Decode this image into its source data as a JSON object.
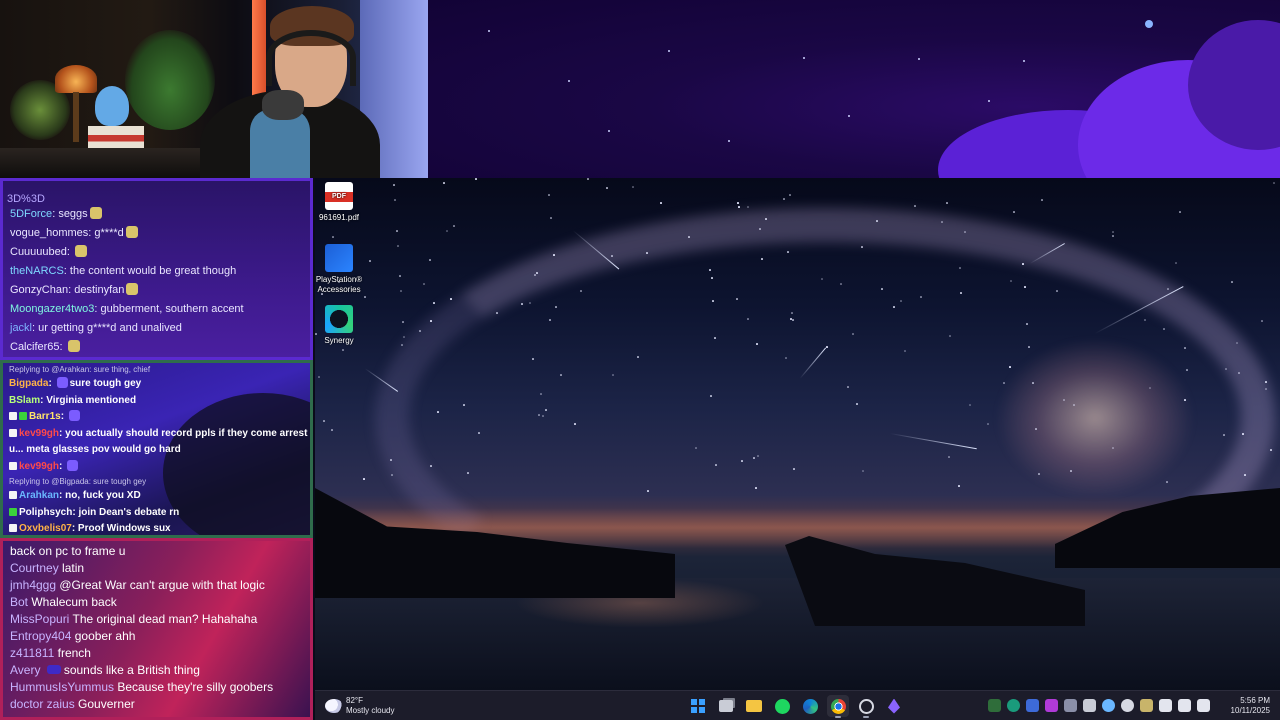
{
  "colors": {
    "chat1_bg": "#3d1a8c",
    "chat2_bg": "#3a24b4",
    "chat3_bg": "#8a1f5a",
    "taskbar": "#1c1c2a"
  },
  "chat1": {
    "header": "3D%3D",
    "messages": [
      {
        "user": "5DForce",
        "user_color": "#7fd9ff",
        "text": "seggs",
        "emote": true
      },
      {
        "user": "vogue_hommes",
        "user_color": "#e9e6ff",
        "text": "g****d",
        "emote": true
      },
      {
        "user": "Cuuuuubed",
        "user_color": "#e9e6ff",
        "text": "",
        "emote": true
      },
      {
        "user": "theNARCS",
        "user_color": "#7fd9ff",
        "text": "the content would be great though",
        "emote": false
      },
      {
        "user": "GonzyChan",
        "user_color": "#e9e6ff",
        "text": "destinyfan",
        "emote": true
      },
      {
        "user": "Moongazer4two3",
        "user_color": "#7ff5e0",
        "text": "gubberment, southern accent",
        "emote": false
      },
      {
        "user": "jackl",
        "user_color": "#7fb4ff",
        "text": "ur getting g****d and unalived",
        "emote": false
      },
      {
        "user": "Calcifer65",
        "user_color": "#e9e6ff",
        "text": "",
        "emote": true
      }
    ]
  },
  "chat2": {
    "lines": [
      {
        "kind": "reply",
        "text": "Replying to @Arahkan: sure thing, chief"
      },
      {
        "kind": "msg",
        "user": "Bigpada",
        "user_color": "#ffb347",
        "text": "sure tough gey",
        "badge": "none",
        "emote_before": true
      },
      {
        "kind": "msg",
        "user": "BSlam",
        "user_color": "#b7ff7a",
        "text": "Virginia mentioned",
        "badge": "none",
        "emote_before": false
      },
      {
        "kind": "msg",
        "user": "Barr1s",
        "user_color": "#ffe46a",
        "text": "",
        "badge": "white-green",
        "emote_before": false
      },
      {
        "kind": "msg",
        "user": "kev99gh",
        "user_color": "#ff4a4a",
        "text": "you actually should record ppls if they come arrest",
        "badge": "white",
        "emote_before": false
      },
      {
        "kind": "cont",
        "text": "u... meta glasses pov would go hard"
      },
      {
        "kind": "msg",
        "user": "kev99gh",
        "user_color": "#ff4a4a",
        "text": "",
        "badge": "white",
        "emote_before": false
      },
      {
        "kind": "reply",
        "text": "Replying to @Bigpada: sure tough gey"
      },
      {
        "kind": "msg",
        "user": "Arahkan",
        "user_color": "#6ab7ff",
        "text": "no, fuck you XD",
        "badge": "white",
        "emote_before": false
      },
      {
        "kind": "msg",
        "user": "Poliphsych",
        "user_color": "#ffffff",
        "text": "join Dean's debate rn",
        "badge": "green",
        "emote_before": false
      },
      {
        "kind": "msg",
        "user": "Oxvbelis07",
        "user_color": "#ffb347",
        "text": "Proof Windows sux",
        "badge": "white",
        "emote_before": false
      }
    ]
  },
  "chat3": {
    "messages": [
      {
        "user": "",
        "text": "back on pc to frame u"
      },
      {
        "user": "Courtney",
        "text": "latin"
      },
      {
        "user": "jmh4ggg",
        "text": "@Great War can't argue with that logic"
      },
      {
        "user": "Bot",
        "text": "Whalecum back"
      },
      {
        "user": "MissPopuri",
        "text": "The original dead man? Hahahaha"
      },
      {
        "user": "Entropy404",
        "text": "goober ahh"
      },
      {
        "user": "z411811",
        "text": "french"
      },
      {
        "user": "Avery",
        "text": "sounds like a British thing",
        "emote": true
      },
      {
        "user": "HummusIsYummus",
        "text": "Because they're silly goobers"
      },
      {
        "user": "doctor zaius",
        "text": "Gouverner"
      }
    ]
  },
  "desktop": {
    "icons": [
      {
        "name": "pdf-file-icon",
        "label": "961691.pdf"
      },
      {
        "name": "playstation-accessories-icon",
        "label": "PlayStation® Accessories"
      },
      {
        "name": "synergy-icon",
        "label": "Synergy"
      }
    ]
  },
  "taskbar": {
    "weather_temp": "82°F",
    "weather_desc": "Mostly cloudy",
    "apps": [
      "start",
      "task-view",
      "file-explorer",
      "spotify",
      "edge",
      "chrome",
      "settings",
      "purple-app"
    ],
    "time": "5:56 PM",
    "date": "10/11/2025"
  }
}
